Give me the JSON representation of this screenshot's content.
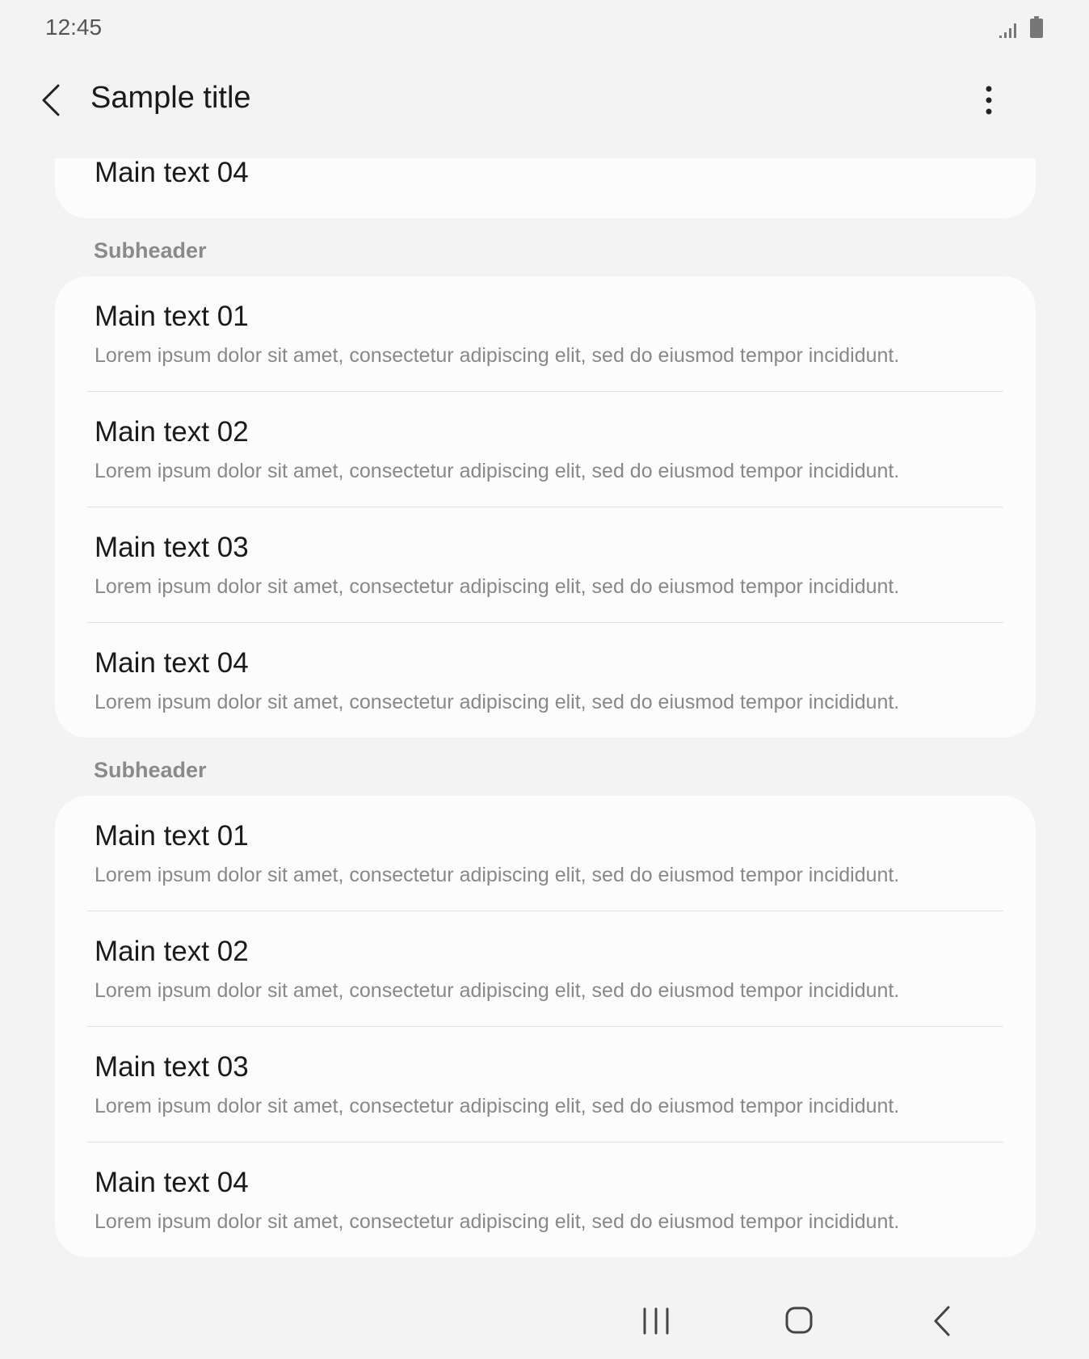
{
  "status_bar": {
    "time": "12:45",
    "icons": [
      "signal-icon",
      "battery-icon"
    ]
  },
  "app_bar": {
    "title": "Sample title",
    "back_icon": "chevron-left-icon",
    "more_icon": "more-vertical-icon"
  },
  "partial_card": {
    "main": "Main text 04"
  },
  "groups": [
    {
      "subheader": "Subheader",
      "items": [
        {
          "main": "Main text 01",
          "sub": "Lorem ipsum dolor sit amet, consectetur adipiscing elit, sed do eiusmod tempor incididunt."
        },
        {
          "main": "Main text 02",
          "sub": "Lorem ipsum dolor sit amet, consectetur adipiscing elit, sed do eiusmod tempor incididunt."
        },
        {
          "main": "Main text 03",
          "sub": "Lorem ipsum dolor sit amet, consectetur adipiscing elit, sed do eiusmod tempor incididunt."
        },
        {
          "main": "Main text 04",
          "sub": "Lorem ipsum dolor sit amet, consectetur adipiscing elit, sed do eiusmod tempor incididunt."
        }
      ]
    },
    {
      "subheader": "Subheader",
      "items": [
        {
          "main": "Main text 01",
          "sub": "Lorem ipsum dolor sit amet, consectetur adipiscing elit, sed do eiusmod tempor incididunt."
        },
        {
          "main": "Main text 02",
          "sub": "Lorem ipsum dolor sit amet, consectetur adipiscing elit, sed do eiusmod tempor incididunt."
        },
        {
          "main": "Main text 03",
          "sub": "Lorem ipsum dolor sit amet, consectetur adipiscing elit, sed do eiusmod tempor incididunt."
        },
        {
          "main": "Main text 04",
          "sub": "Lorem ipsum dolor sit amet, consectetur adipiscing elit, sed do eiusmod tempor incididunt."
        }
      ]
    }
  ],
  "nav_bar": {
    "icons": [
      "recent-apps-icon",
      "home-icon",
      "back-icon"
    ]
  },
  "colors": {
    "background": "#f3f3f3",
    "card": "#fcfcfc",
    "primary_text": "#1a1a1a",
    "secondary_text": "#888888",
    "divider": "#e2e2e2"
  }
}
